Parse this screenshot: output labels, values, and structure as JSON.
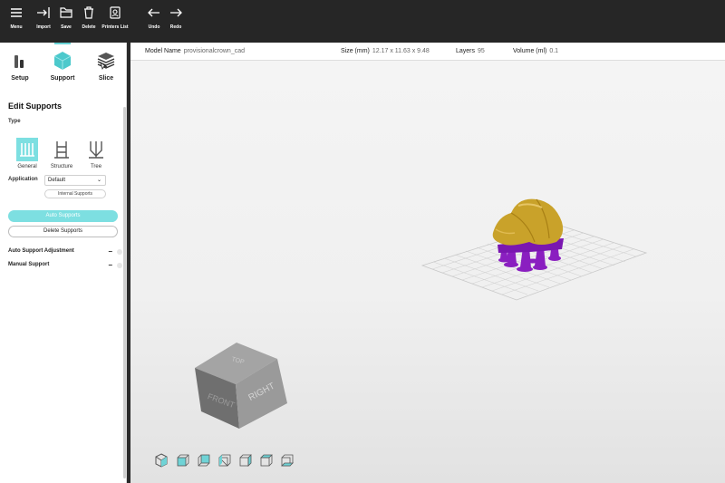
{
  "toolbar": {
    "menu": "Menu",
    "import": "Import",
    "save": "Save",
    "delete": "Delete",
    "printers": "Printers List",
    "undo": "Undo",
    "redo": "Redo"
  },
  "modes": {
    "setup": "Setup",
    "support": "Support",
    "slice": "Slice"
  },
  "panel": {
    "title": "Edit Supports",
    "type_label": "Type",
    "types": [
      "General",
      "Structure",
      "Tree"
    ],
    "application_label": "Application",
    "application_value": "Default",
    "internal_supports": "Internal Supports",
    "auto_supports": "Auto Supports",
    "delete_supports": "Delete Supports",
    "accordion": [
      {
        "label": "Auto Support Adjustment",
        "state": "−"
      },
      {
        "label": "Manual Support",
        "state": "−"
      }
    ]
  },
  "info": {
    "model_name_label": "Model Name",
    "model_name": "provisionalcrown_cad",
    "size_label": "Size (mm)",
    "size": "12.17 x 11.63 x 9.48",
    "layers_label": "Layers",
    "layers": "95",
    "volume_label": "Volume (ml)",
    "volume": "0.1"
  },
  "view_cube": {
    "top": "TOP",
    "front": "FRONT",
    "right": "RIGHT"
  },
  "colors": {
    "accent": "#69d3d6",
    "model": "#c9a22a",
    "supports": "#8a1fc0",
    "toolbar": "#262626"
  }
}
